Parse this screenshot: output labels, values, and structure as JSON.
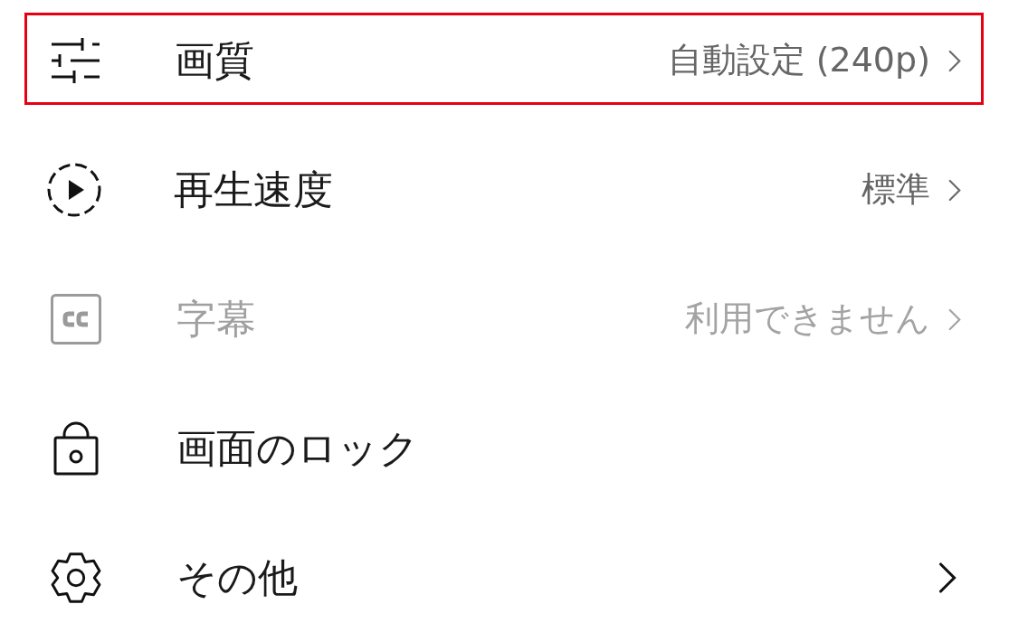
{
  "menu": {
    "items": [
      {
        "label": "画質",
        "value": "自動設定 (240p)",
        "has_submenu": true,
        "highlighted": true,
        "disabled": false
      },
      {
        "label": "再生速度",
        "value": "標準",
        "has_submenu": true,
        "highlighted": false,
        "disabled": false
      },
      {
        "label": "字幕",
        "value": "利用できません",
        "has_submenu": true,
        "highlighted": false,
        "disabled": true
      },
      {
        "label": "画面のロック",
        "has_submenu": false,
        "highlighted": false,
        "disabled": false
      },
      {
        "label": "その他",
        "has_submenu": true,
        "highlighted": false,
        "disabled": false
      }
    ]
  }
}
